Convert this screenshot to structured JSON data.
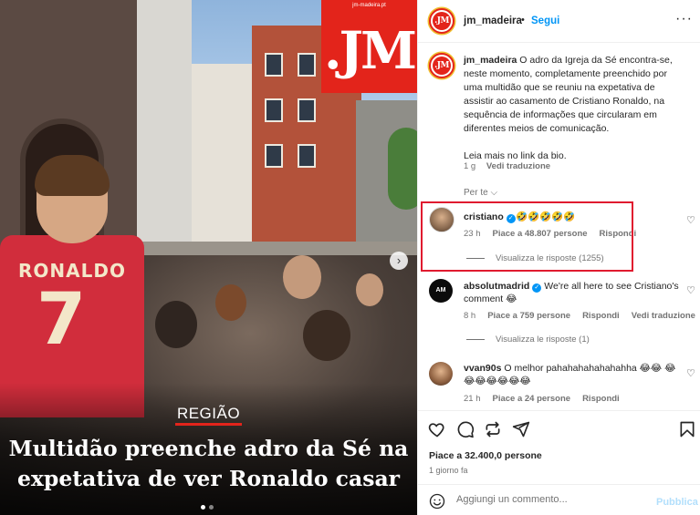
{
  "media": {
    "logo_url": "jm-madeira.pt",
    "logo_text": ".JM",
    "shirt_name": "RONALDO",
    "shirt_number": "7",
    "region_label": "REGIÃO",
    "headline": "Multidão preenche adro da Sé na expetativa de ver Ronaldo casar"
  },
  "header": {
    "username": "jm_madeira",
    "separator": "•",
    "follow_label": "Segui",
    "more_label": "···",
    "avatar_text": ".JM"
  },
  "caption": {
    "username": "jm_madeira",
    "text": "O adro da Igreja da Sé encontra-se, neste momento, completamente preenchido por uma multidão que se reuniu na expetativa de assistir ao casamento de Cristiano Ronaldo, na sequência de informações que circularam em diferentes meios de comunicação.",
    "text2": "Leia mais no link da bio.",
    "time": "1 g",
    "translate": "Vedi traduzione"
  },
  "for_you": "Per te ⌵",
  "comments": [
    {
      "username": "cristiano",
      "verified": true,
      "text": "🤣🤣🤣🤣🤣",
      "time": "23 h",
      "likes": "Piace a 48.807 persone",
      "reply": "Rispondi",
      "view_replies": "Visualizza le risposte (1255)"
    },
    {
      "username": "absolutmadrid",
      "verified": true,
      "avatar_text": "AM",
      "text": "We're all here to see Cristiano's comment 😂",
      "time": "8 h",
      "likes": "Piace a 759 persone",
      "reply": "Rispondi",
      "translate": "Vedi traduzione",
      "view_replies": "Visualizza le risposte (1)"
    },
    {
      "username": "vvan90s",
      "verified": false,
      "text": "O melhor pahahahahahahahha 😂😂 😂😂😂😂😂😂😂",
      "time": "21 h",
      "likes": "Piace a 24 persone",
      "reply": "Rispondi"
    }
  ],
  "footer": {
    "likes": "Piace a 32.400,0 persone",
    "date": "1 giorno fa",
    "comment_placeholder": "Aggiungi un commento...",
    "publish_label": "Pubblica"
  },
  "colors": {
    "accent_blue": "#0095f6",
    "brand_red": "#e3241b",
    "highlight_red": "#e01b2f"
  }
}
